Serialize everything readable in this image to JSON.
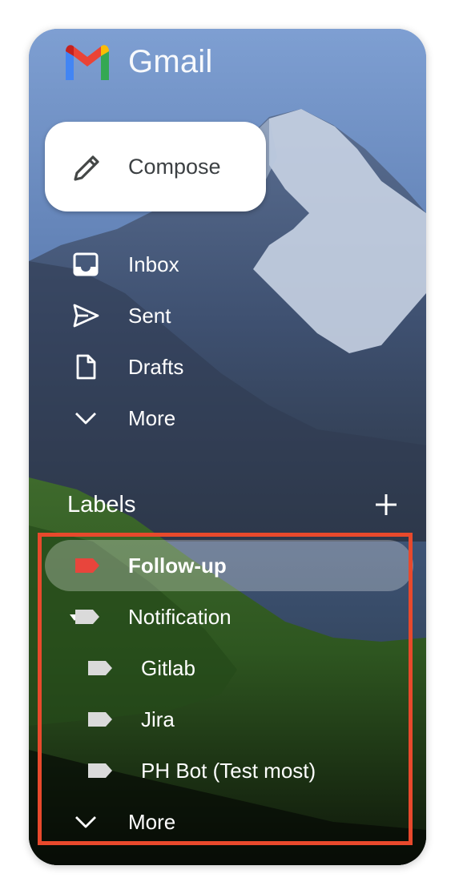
{
  "app": {
    "name": "Gmail",
    "logo_icon": "gmail-m-logo"
  },
  "compose": {
    "label": "Compose",
    "icon": "pencil-icon"
  },
  "nav": [
    {
      "label": "Inbox",
      "icon": "inbox-icon"
    },
    {
      "label": "Sent",
      "icon": "send-icon"
    },
    {
      "label": "Drafts",
      "icon": "draft-document-icon"
    },
    {
      "label": "More",
      "icon": "chevron-down-icon"
    }
  ],
  "labels": {
    "heading": "Labels",
    "add_icon": "plus-icon",
    "items": [
      {
        "label": "Follow-up",
        "color": "#e8453c",
        "active": true
      },
      {
        "label": "Notification",
        "color": "#dadada",
        "expanded": true
      },
      {
        "label": "Gitlab",
        "color": "#dadada",
        "nested": true
      },
      {
        "label": "Jira",
        "color": "#dadada",
        "nested": true
      },
      {
        "label": "PH Bot (Test most)",
        "color": "#dadada",
        "nested": true
      }
    ],
    "more_label": "More"
  },
  "colors": {
    "highlight_border": "#e8492c",
    "follow_up_tag": "#e8453c",
    "default_tag": "#dadada"
  }
}
